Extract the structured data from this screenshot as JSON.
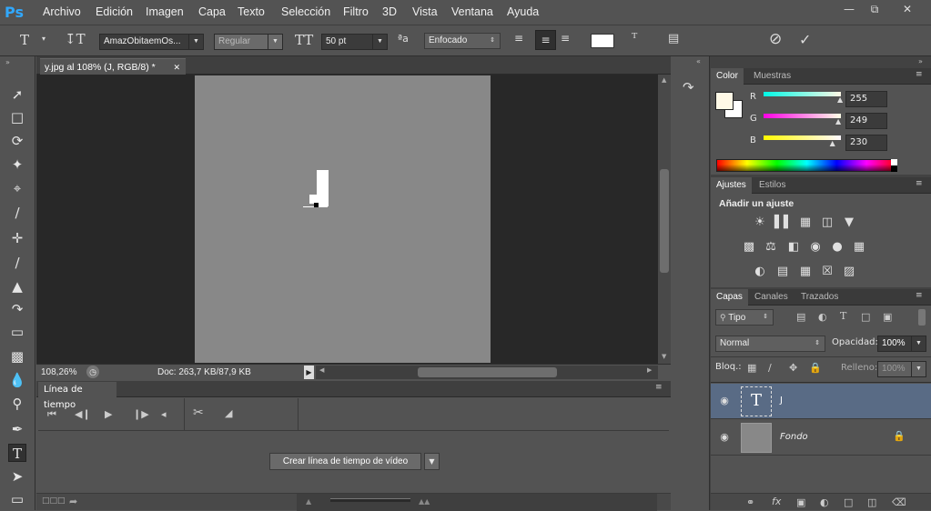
{
  "app": {
    "logo": "Ps"
  },
  "menu": [
    "Archivo",
    "Edición",
    "Imagen",
    "Capa",
    "Texto",
    "Selección",
    "Filtro",
    "3D",
    "Vista",
    "Ventana",
    "Ayuda"
  ],
  "options": {
    "font_family": "AmazObitaemOs...",
    "font_style": "Regular",
    "font_size": "50 pt",
    "aa_label": "ªa",
    "antialias": "Enfocado"
  },
  "document": {
    "tab_title": "y.jpg al 108% (J, RGB/8) *",
    "canvas_text": "J",
    "zoom": "108,26%",
    "doc_info": "Doc: 263,7 KB/87,9 KB"
  },
  "timeline": {
    "tab_label": "Línea de tiempo",
    "create_button": "Crear línea de tiempo de vídeo"
  },
  "color_panel": {
    "tabs": [
      "Color",
      "Muestras"
    ],
    "r_label": "R",
    "g_label": "G",
    "b_label": "B",
    "r": "255",
    "g": "249",
    "b": "230",
    "r_level": 1.0,
    "g_level": 0.976,
    "b_level": 0.902,
    "foreground": "#fff9e6"
  },
  "adjust_panel": {
    "tabs": [
      "Ajustes",
      "Estilos"
    ],
    "title": "Añadir un ajuste"
  },
  "layers_panel": {
    "tabs": [
      "Capas",
      "Canales",
      "Trazados"
    ],
    "filter": "Tipo",
    "blend_mode": "Normal",
    "opacity_label": "Opacidad:",
    "opacity": "100%",
    "lock_label": "Bloq.:",
    "fill_label": "Relleno:",
    "fill": "100%",
    "layers": [
      {
        "name": "J",
        "type": "text"
      },
      {
        "name": "Fondo",
        "type": "background"
      }
    ]
  }
}
